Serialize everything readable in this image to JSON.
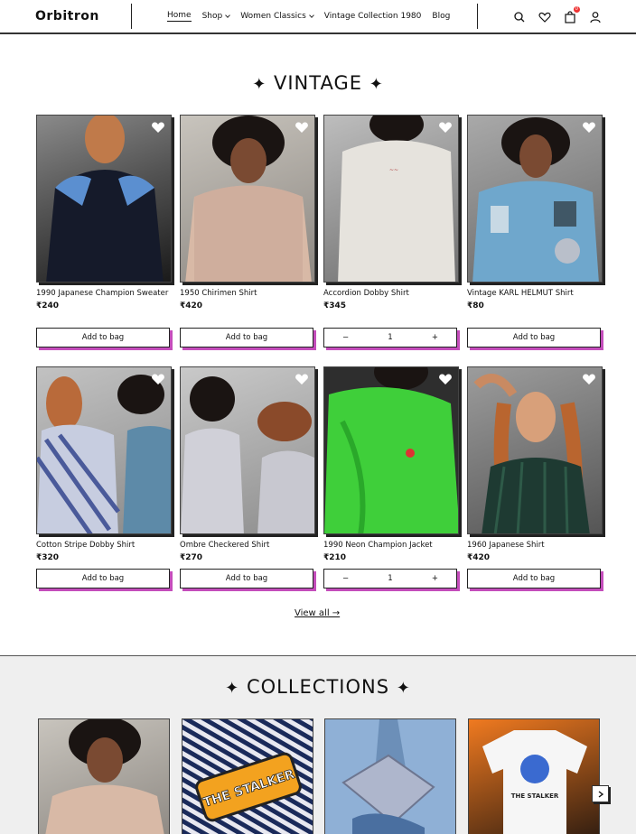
{
  "header": {
    "logo": "Orbitron",
    "nav": [
      {
        "label": "Home"
      },
      {
        "label": "Shop"
      },
      {
        "label": "Women Classics"
      },
      {
        "label": "Vintage Collection 1980"
      },
      {
        "label": "Blog"
      }
    ],
    "cart_count": "0",
    "icons": [
      "search-icon",
      "heart-icon",
      "bag-icon",
      "user-icon"
    ]
  },
  "vintage": {
    "title": "VINTAGE",
    "star": "✦",
    "products": [
      {
        "name": "1990 Japanese Champion Sweater",
        "price": "₹240",
        "button": "Add to bag"
      },
      {
        "name": "1950 Chirimen Shirt",
        "price": "₹420",
        "button": "Add to bag"
      },
      {
        "name": "Accordion Dobby Shirt",
        "price": "₹345",
        "qty": "1",
        "minus": "−",
        "plus": "+"
      },
      {
        "name": "Vintage KARL HELMUT Shirt",
        "price": "₹80",
        "button": "Add to bag"
      },
      {
        "name": "Cotton Stripe Dobby Shirt",
        "price": "₹320",
        "button": "Add to bag"
      },
      {
        "name": "Ombre Checkered Shirt",
        "price": "₹270",
        "button": "Add to bag"
      },
      {
        "name": "1990 Neon Champion Jacket",
        "price": "₹210",
        "qty": "1",
        "minus": "−",
        "plus": "+"
      },
      {
        "name": "1960 Japanese Shirt",
        "price": "₹420",
        "button": "Add to bag"
      }
    ],
    "view_all": "View all →"
  },
  "collections": {
    "title": "COLLECTIONS",
    "star": "✦",
    "items": [
      {
        "text": ""
      },
      {
        "text": "THE STALKER"
      },
      {
        "text": ""
      },
      {
        "text": "THE STALKER"
      }
    ]
  },
  "colors": {
    "accent_shadow": "#c44dbb",
    "badge": "#ee3333"
  }
}
